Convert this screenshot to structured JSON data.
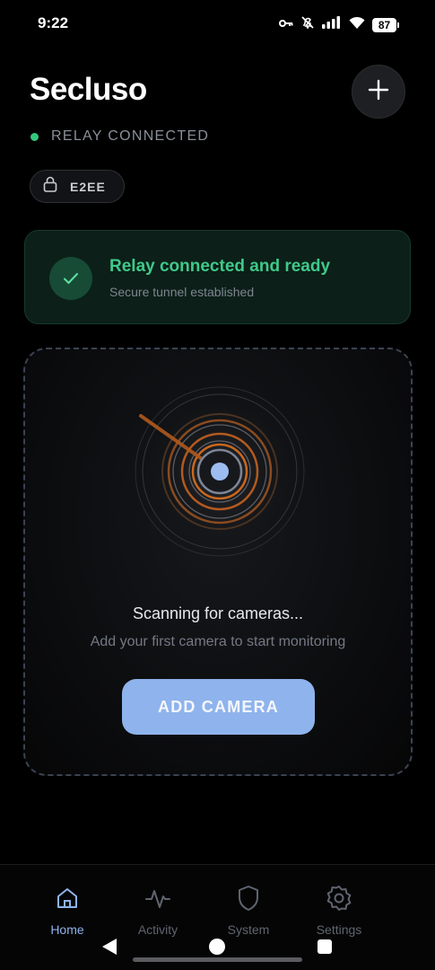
{
  "status_bar": {
    "time": "9:22",
    "battery": "87",
    "icons": [
      "key-icon",
      "mute-icon",
      "signal-icon",
      "wifi-icon",
      "battery-icon"
    ]
  },
  "header": {
    "title": "Secluso",
    "add_icon": "plus-icon",
    "relay_status": "RELAY CONNECTED",
    "relay_status_color": "#34c77b",
    "e2ee_label": "E2EE"
  },
  "relay_card": {
    "title": "Relay connected and ready",
    "subtitle": "Secure tunnel established",
    "accent": "#3fc98a"
  },
  "scan": {
    "title": "Scanning for cameras...",
    "subtitle": "Add your first camera to start monitoring",
    "button_label": "ADD CAMERA",
    "button_color": "#8fb3ec"
  },
  "nav": {
    "items": [
      {
        "label": "Home",
        "icon": "home-icon",
        "active": true
      },
      {
        "label": "Activity",
        "icon": "activity-icon",
        "active": false
      },
      {
        "label": "System",
        "icon": "shield-icon",
        "active": false
      },
      {
        "label": "Settings",
        "icon": "gear-icon",
        "active": false
      }
    ]
  }
}
